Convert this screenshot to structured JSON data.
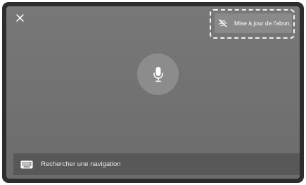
{
  "header": {
    "close_icon": "close-icon",
    "subscription_button": {
      "label": "Mise à jour de l'abon.",
      "icon": "no-subscription-icon"
    }
  },
  "main": {
    "mic_icon": "microphone-icon"
  },
  "search": {
    "icon": "keyboard-icon",
    "label": "Rechercher une navigation"
  }
}
